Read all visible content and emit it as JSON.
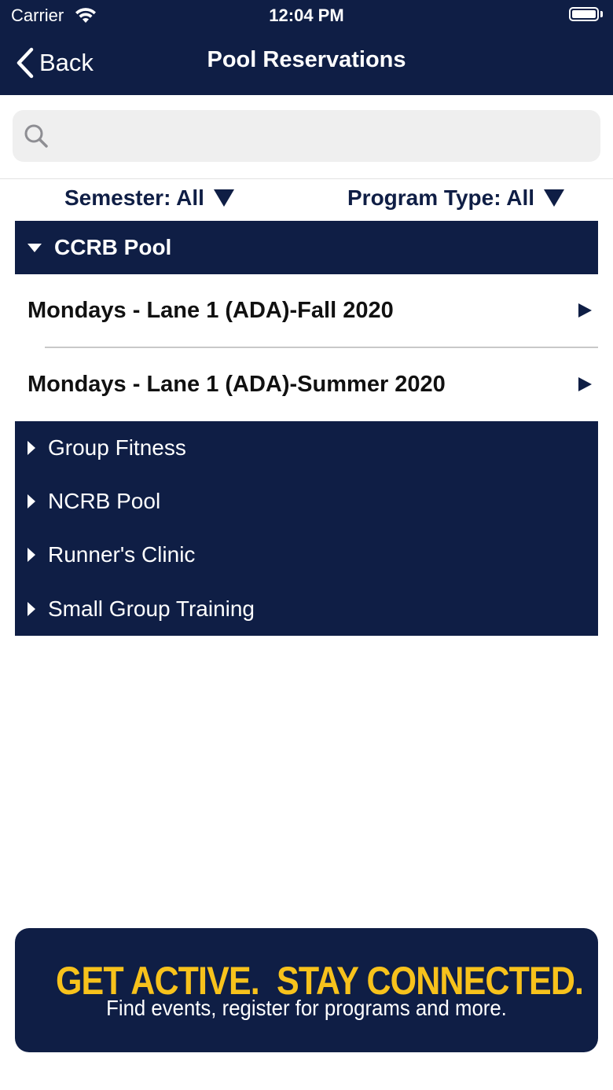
{
  "status_bar": {
    "carrier": "Carrier",
    "time": "12:04 PM"
  },
  "nav": {
    "back_label": "Back",
    "title": "Pool Reservations"
  },
  "search": {
    "placeholder": ""
  },
  "filters": {
    "semester": "Semester: All",
    "program_type": "Program Type: All"
  },
  "expanded_section": {
    "label": "CCRB Pool",
    "items": [
      {
        "label": "Mondays - Lane 1 (ADA)-Fall 2020"
      },
      {
        "label": "Mondays - Lane 1 (ADA)-Summer 2020"
      }
    ]
  },
  "collapsed_sections": [
    {
      "label": "Group Fitness"
    },
    {
      "label": "NCRB Pool"
    },
    {
      "label": "Runner's Clinic"
    },
    {
      "label": "Small Group Training"
    }
  ],
  "banner": {
    "headline": "GET ACTIVE.  STAY CONNECTED.",
    "subline": "Find events, register for programs and more."
  },
  "colors": {
    "navy": "#0f1e45",
    "accent_yellow": "#f7c21c"
  },
  "icons": [
    "wifi-icon",
    "battery-icon",
    "chevron-left-icon",
    "search-icon",
    "dropdown-triangle-icon",
    "disclosure-arrow-icon"
  ]
}
